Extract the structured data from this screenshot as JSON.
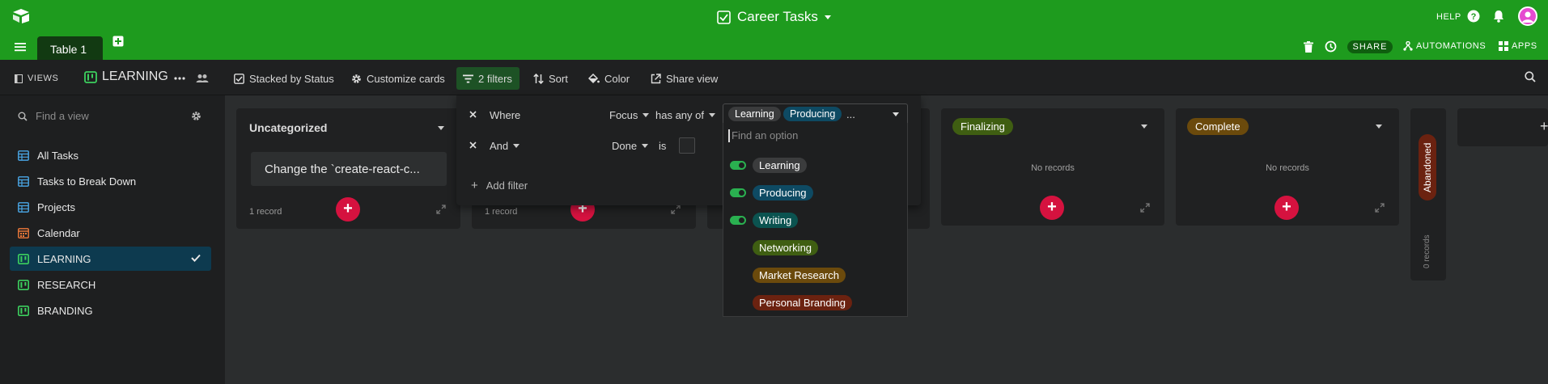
{
  "app": {
    "base_title": "Career Tasks",
    "help_label": "HELP"
  },
  "tabbar": {
    "table_tab": "Table 1",
    "share_label": "SHARE",
    "automations_label": "AUTOMATIONS",
    "apps_label": "APPS"
  },
  "viewbar": {
    "views_label": "VIEWS",
    "current_view": "LEARNING",
    "stacked_label": "Stacked by Status",
    "customize_label": "Customize cards",
    "filters_label": "2 filters",
    "sort_label": "Sort",
    "color_label": "Color",
    "share_view_label": "Share view"
  },
  "sidebar": {
    "search_placeholder": "Find a view",
    "items": [
      {
        "label": "All Tasks",
        "icon": "grid-icon"
      },
      {
        "label": "Tasks to Break Down",
        "icon": "grid-icon"
      },
      {
        "label": "Projects",
        "icon": "grid-icon"
      },
      {
        "label": "Calendar",
        "icon": "calendar-icon"
      },
      {
        "label": "LEARNING",
        "icon": "kanban-icon"
      },
      {
        "label": "RESEARCH",
        "icon": "kanban-icon"
      },
      {
        "label": "BRANDING",
        "icon": "kanban-icon"
      }
    ]
  },
  "board": {
    "columns": [
      {
        "title": "Uncategorized",
        "card": "Change the `create-react-c...",
        "count": "1 record"
      },
      {
        "count": "1 record"
      },
      {
        "title": "Finalizing",
        "empty": "No records",
        "color": "#3f5e12"
      },
      {
        "title": "Complete",
        "empty": "No records",
        "color": "#6b4a0c"
      }
    ],
    "collapsed": {
      "title": "Abandoned",
      "count": "0 records",
      "color": "#6b2210"
    }
  },
  "filter": {
    "row1": {
      "conj": "Where",
      "field": "Focus",
      "op": "has any of",
      "values": [
        "Learning",
        "Producing"
      ],
      "more": "..."
    },
    "row2": {
      "conj": "And",
      "field": "Done",
      "op": "is"
    },
    "add_label": "Add filter"
  },
  "dropdown": {
    "search_placeholder": "Find an option",
    "options": [
      {
        "label": "Learning",
        "checked": true,
        "color": "#3b3c3d"
      },
      {
        "label": "Producing",
        "checked": true,
        "color": "#0e4a63"
      },
      {
        "label": "Writing",
        "checked": true,
        "color": "#0b5350"
      },
      {
        "label": "Networking",
        "checked": false,
        "color": "#3f5e12"
      },
      {
        "label": "Market Research",
        "checked": false,
        "color": "#6b4a0c"
      },
      {
        "label": "Personal Branding",
        "checked": false,
        "color": "#6b2210"
      }
    ]
  },
  "colors": {
    "brand_green": "#1e9b1e",
    "accent_red": "#d5123f"
  }
}
